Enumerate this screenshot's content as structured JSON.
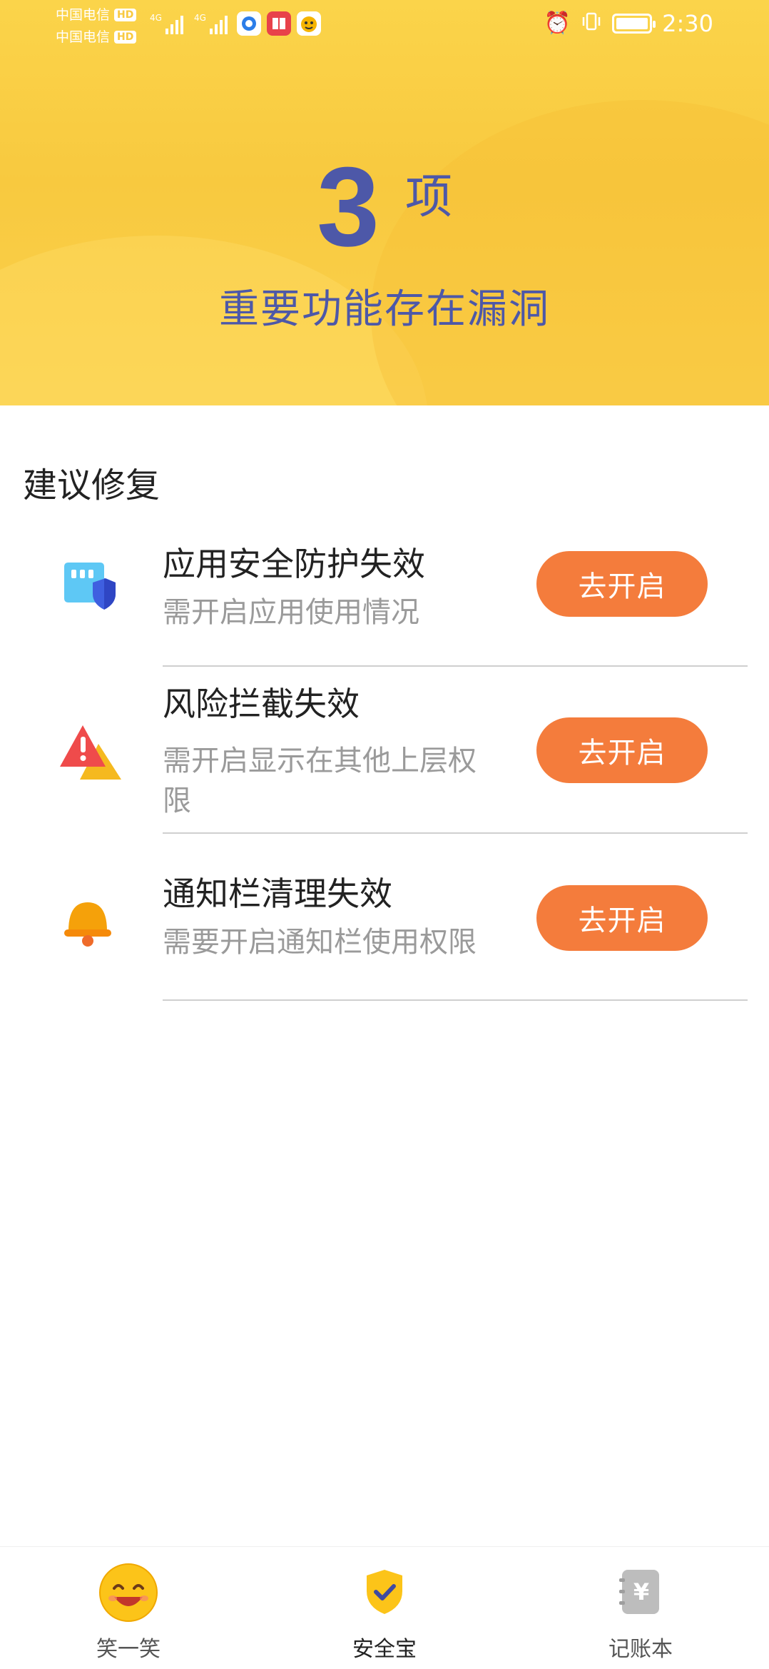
{
  "status_bar": {
    "carrier1": "中国电信",
    "carrier2": "中国电信",
    "hd": "HD",
    "network1": "4G",
    "network2": "4G",
    "time": "2:30"
  },
  "hero": {
    "count": "3",
    "unit": "项",
    "subtitle": "重要功能存在漏洞"
  },
  "section": {
    "title": "建议修复"
  },
  "items": [
    {
      "title": "应用安全防护失效",
      "desc": "需开启应用使用情况",
      "button": "去开启",
      "icon": "app-shield-icon"
    },
    {
      "title": "风险拦截失效",
      "desc": "需开启显示在其他上层权限",
      "button": "去开启",
      "icon": "warning-icon"
    },
    {
      "title": "通知栏清理失效",
      "desc": "需要开启通知栏使用权限",
      "button": "去开启",
      "icon": "bell-icon"
    }
  ],
  "bottom_nav": [
    {
      "label": "笑一笑",
      "icon": "smiley-icon",
      "active": false
    },
    {
      "label": "安全宝",
      "icon": "shield-check-icon",
      "active": true
    },
    {
      "label": "记账本",
      "icon": "yen-notebook-icon",
      "active": false
    }
  ],
  "colors": {
    "hero_bg": "#f8c93f",
    "hero_text": "#4d58a8",
    "button": "#f47c3c",
    "desc_text": "#9a9a9a"
  }
}
